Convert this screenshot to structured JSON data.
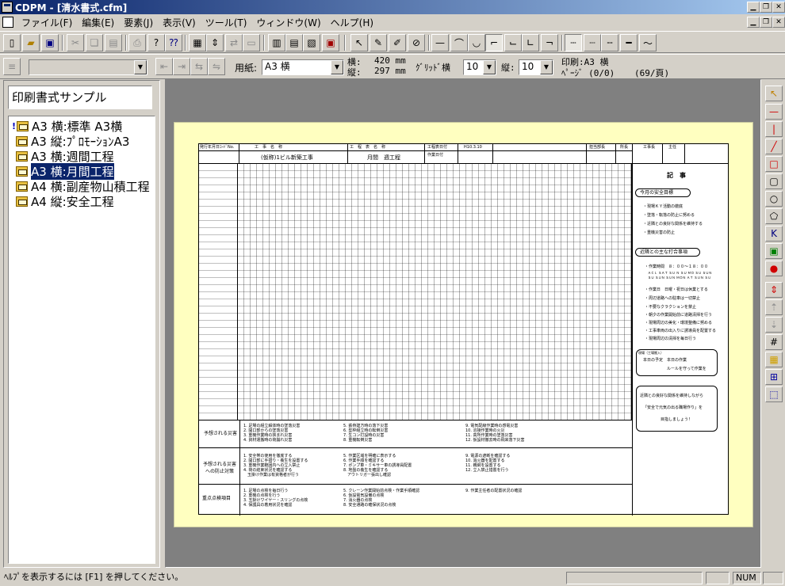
{
  "window": {
    "title": "CDPM - [清水書式.cfm]"
  },
  "menu": [
    "ファイル(F)",
    "編集(E)",
    "要素(J)",
    "表示(V)",
    "ツール(T)",
    "ウィンドウ(W)",
    "ヘルプ(H)"
  ],
  "toolbar2": {
    "paper_label": "用紙:",
    "paper_value": "A3 横",
    "size_width_label": "横:",
    "size_width_value": "420 mm",
    "size_height_label": "縦:",
    "size_height_value": "297 mm",
    "grid_width_label": "ｸﾞﾘｯﾄﾞ横",
    "grid_width_value": "10",
    "grid_height_label": "縦:",
    "grid_height_value": "10",
    "print_label": "印刷:A3 横",
    "page_label": "ﾍﾟｰｼﾞ (0/0)",
    "page_count_label": "(69/頁)"
  },
  "left": {
    "name_value": "印刷書式サンプル",
    "items": [
      {
        "label": "A3 横:標準 A3横",
        "selected": false,
        "marked": true
      },
      {
        "label": "A3 縦:ﾌﾟﾛﾓｰｼｮﾝA3",
        "selected": false,
        "marked": false
      },
      {
        "label": "A3 横:週間工程",
        "selected": false,
        "marked": false
      },
      {
        "label": "A3 横:月間工程",
        "selected": true,
        "marked": false
      },
      {
        "label": "A4 横:副産物山積工程",
        "selected": false,
        "marked": false
      },
      {
        "label": "A4 縦:安全工程",
        "selected": false,
        "marked": false
      }
    ]
  },
  "sheet": {
    "header_cells": [
      "発行年月日ｺｰﾄﾞNo.",
      "工　事　名　称",
      "工　程　表　名　称",
      "工程表日付",
      "H10.3.10",
      "作業日付",
      "担当部長",
      "所長",
      "工事長",
      "主任"
    ],
    "project_name": "(仮称)1ビル新築工事",
    "schedule_name": "月間　週工程",
    "notes_title": "記　事",
    "goal_title": "今月の安全目標",
    "goals": [
      "・現場ＫＹ活動の徹底",
      "・墜落・転落の防止に努める",
      "・近隣との良好な関係を維持する",
      "・重機災害の防止"
    ],
    "rules_title": "近隣との主な打合事項",
    "rules": [
      "・作業時間　８：００～１８：００",
      "ＡＣＬ ＳＡＴ ＳＵ Ｎ ＳＵ ＭＯ ＳＵ ＳＵＮ",
      "ＳＵ ＳＵＮ ＳＵＮ ＭＯＮ ＡＴ ＳＵＮ ＳＵ",
      "・作業日　日曜・祝日は休業とする",
      "・周辺道路への駐車は一切禁止",
      "・不要なクラクションを禁止",
      "・朝夕の作業開始前に道路清掃を行う",
      "・現場周辺の美化・環境整備に努める",
      "・工事車両の出入りに誘導員を配置する",
      "・現場周辺の清掃を毎日行う"
    ],
    "box1_title": "現場（工場搬入）",
    "box1_lines": [
      "本日の予定　本日の作業",
      "ルールを守って作業を"
    ],
    "box2_lines": [
      "近隣との良好な関係を維持しながら",
      "「安全で元気の出る職場作り」を",
      "目指しましょう！"
    ],
    "row_labels": [
      "予想される災害",
      "予想される災害への防止対策",
      "重点点検項目"
    ],
    "row1_cols": [
      [
        "1. 足場の組立解体時の墜落災害",
        "2. 開口部からの墜落災害",
        "3. 重機作業時の挟まれ災害",
        "4. 資材運搬時の荷崩れ災害"
      ],
      [
        "5. 鉄骨建方時の落下災害",
        "6. 型枠組立時の転倒災害",
        "7. 生コン打設時の災害",
        "8. 重機転倒災害"
      ],
      [
        "9. 電気配線作業時の感電災害",
        "10. 溶接作業時の火災",
        "11. 高所作業時の墜落災害",
        "12. 仮設材撤去時の飛来落下災害"
      ]
    ],
    "row2_cols": [
      [
        "1. 安全帯の使用を徹底する",
        "2. 開口部に手摺り・養生を設置する",
        "3. 重機作業範囲内への立入禁止",
        "4. 荷の結束状況を確認する",
        "　玉掛け作業は有資格者が行う"
      ],
      [
        "5. 作業区域を明確に表示する",
        "6. 作業手順を確認する",
        "7. ポンプ車・ミキサー車の誘導員配置",
        "8. 地盤の養生を確認する",
        "　アウトリガー張出し確認"
      ],
      [
        "9. 電源の遮断を確認する",
        "10. 消火器を配置する",
        "11. 親綱を設置する",
        "12. 立入禁止措置を行う"
      ]
    ],
    "row3_cols": [
      [
        "1. 足場の点検を毎日行う",
        "2. 重機の点検を行う",
        "3. 玉掛けワイヤー・スリングの点検",
        "4. 保護具の着用状況を確認"
      ],
      [
        "5. クレーン作業開始前点検・作業手順確認",
        "6. 仮設電気設備の点検",
        "7. 消火器の点検",
        "8. 安全通路の確保状況の点検"
      ],
      [
        "9. 作業主任者の配置状況の確認"
      ]
    ]
  },
  "status": {
    "help_text": "ﾍﾙﾌﾟを表示するには [F1] を押してください。",
    "num": "NUM"
  }
}
